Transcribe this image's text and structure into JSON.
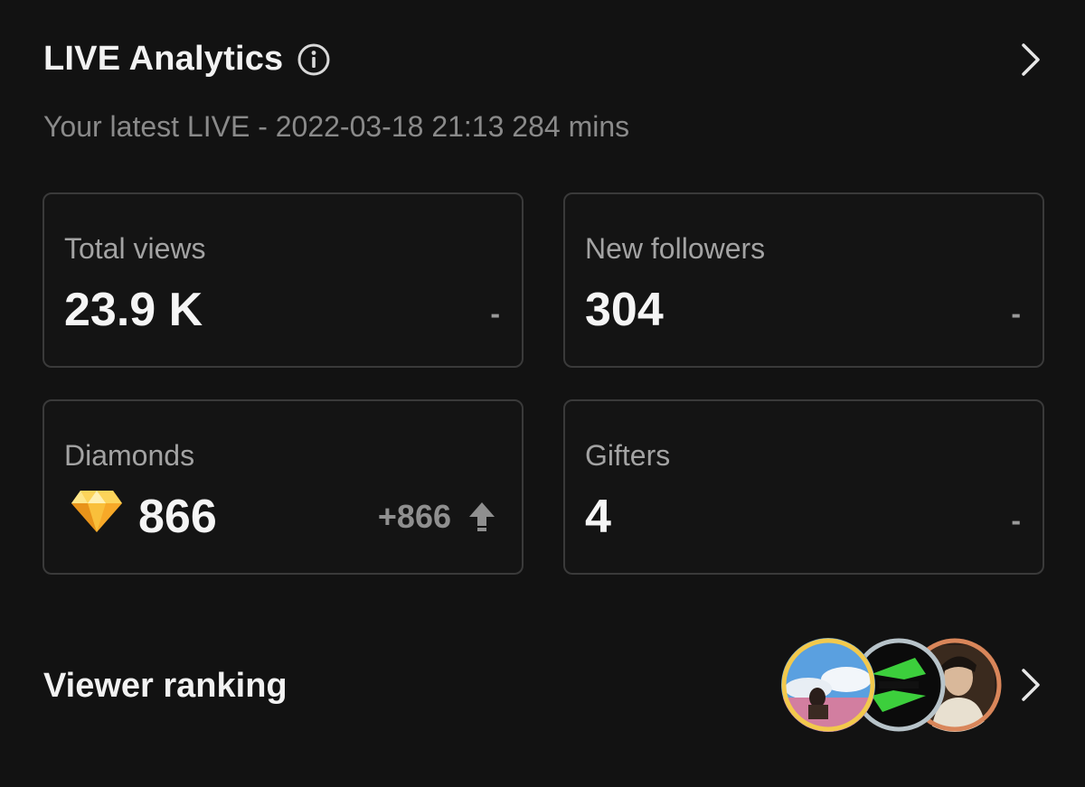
{
  "header": {
    "title": "LIVE Analytics",
    "subtitle": "Your latest LIVE - 2022-03-18 21:13 284 mins"
  },
  "icons": {
    "info": "info-circle-icon",
    "chevron": "chevron-right-icon",
    "diamond": "diamond-icon",
    "arrow": "arrow-up-icon"
  },
  "stats": {
    "total_views": {
      "label": "Total views",
      "value": "23.9 K",
      "change": "-"
    },
    "new_followers": {
      "label": "New followers",
      "value": "304",
      "change": "-"
    },
    "diamonds": {
      "label": "Diamonds",
      "value": "866",
      "change": "+866"
    },
    "gifters": {
      "label": "Gifters",
      "value": "4",
      "change": "-"
    }
  },
  "ranking": {
    "label": "Viewer ranking",
    "avatars": [
      {
        "rank": 1,
        "ring_color": "#f2c94c"
      },
      {
        "rank": 2,
        "ring_color": "#b7c3c9"
      },
      {
        "rank": 3,
        "ring_color": "#d9865a"
      }
    ]
  },
  "colors": {
    "background": "#121212",
    "card_border": "#3a3a3a",
    "muted_text": "#8a8a8a",
    "diamond": "#f7a928"
  }
}
